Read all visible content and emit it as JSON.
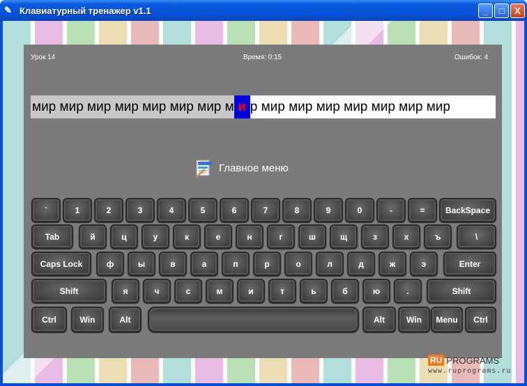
{
  "window": {
    "title": "Клавиатурный тренажер v1.1",
    "minimize": "_",
    "maximize": "□",
    "close": "X"
  },
  "status": {
    "lesson": "Урок 14",
    "time": "Время: 0:15",
    "errors": "Ошибок: 4"
  },
  "strip": {
    "typed": "мир мир мир мир мир мир мир м",
    "current": "и",
    "rest": "р мир мир мир мир мир мир мир",
    "colors": {
      "typed_bg": "#c8c8c8",
      "cursor_bg": "#0000e0",
      "cursor_fg": "#ff0000"
    }
  },
  "menu": {
    "label": "Главное меню",
    "icon": "menu-document-icon"
  },
  "keyboard": {
    "rows": [
      [
        "`",
        "1",
        "2",
        "3",
        "4",
        "5",
        "6",
        "7",
        "8",
        "9",
        "0",
        "-",
        "=",
        "BackSpace"
      ],
      [
        "Tab",
        "й",
        "ц",
        "у",
        "к",
        "е",
        "н",
        "г",
        "ш",
        "щ",
        "з",
        "х",
        "ъ",
        "\\"
      ],
      [
        "Caps Lock",
        "ф",
        "ы",
        "в",
        "а",
        "п",
        "р",
        "о",
        "л",
        "д",
        "ж",
        "э",
        "Enter"
      ],
      [
        "Shift",
        "я",
        "ч",
        "с",
        "м",
        "и",
        "т",
        "ь",
        "б",
        "ю",
        ".",
        "Shift"
      ],
      [
        "Ctrl",
        "Win",
        "Alt",
        "",
        "Alt",
        "Win",
        "Menu",
        "Ctrl"
      ]
    ]
  },
  "watermark": {
    "logo": "RU",
    "text": "PROGRAMS",
    "url": "www.ruprograms.ru"
  }
}
